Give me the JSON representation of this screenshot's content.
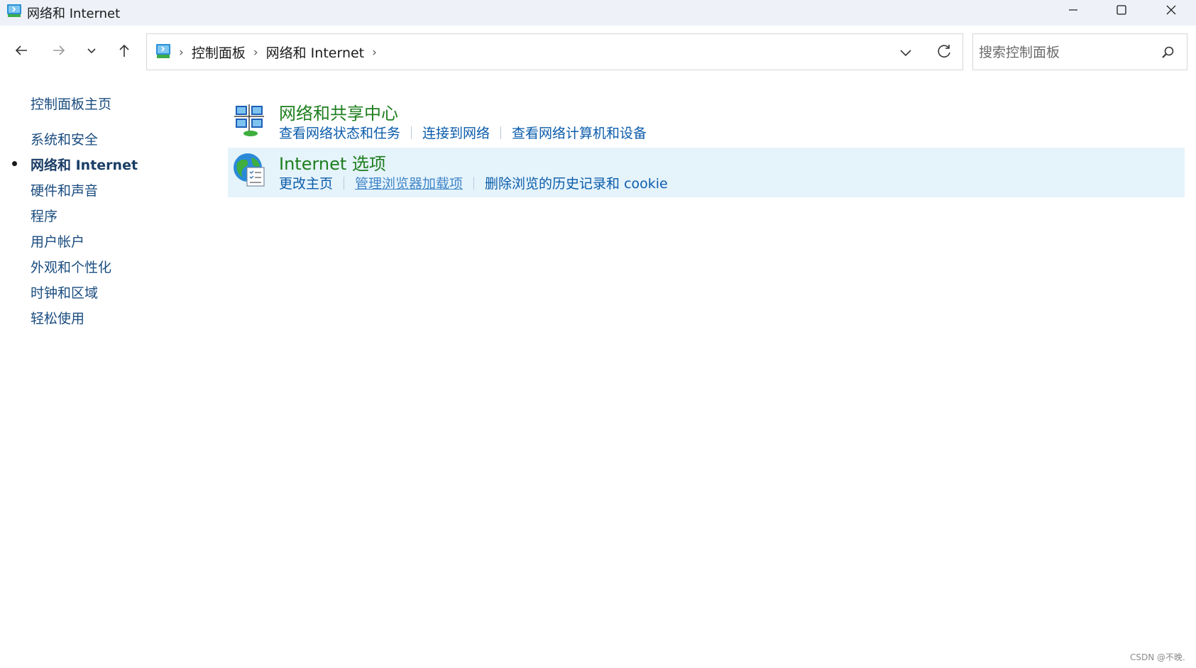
{
  "window": {
    "title": "网络和 Internet",
    "icons": {
      "app": "control-panel-icon",
      "minimize": "minimize-icon",
      "maximize": "maximize-icon",
      "close": "close-icon"
    }
  },
  "nav": {
    "back_icon": "arrow-left-icon",
    "forward_icon": "arrow-right-icon",
    "recent_icon": "chevron-down-icon",
    "up_icon": "arrow-up-icon"
  },
  "address": {
    "crumbs": [
      "控制面板",
      "网络和 Internet"
    ],
    "dropdown_icon": "chevron-down-icon",
    "refresh_icon": "refresh-icon"
  },
  "search": {
    "placeholder": "搜索控制面板",
    "icon": "search-icon"
  },
  "sidebar": {
    "home": "控制面板主页",
    "items": [
      {
        "label": "系统和安全",
        "active": false
      },
      {
        "label": "网络和 Internet",
        "active": true
      },
      {
        "label": "硬件和声音",
        "active": false
      },
      {
        "label": "程序",
        "active": false
      },
      {
        "label": "用户帐户",
        "active": false
      },
      {
        "label": "外观和个性化",
        "active": false
      },
      {
        "label": "时钟和区域",
        "active": false
      },
      {
        "label": "轻松使用",
        "active": false
      }
    ]
  },
  "categories": [
    {
      "title": "网络和共享中心",
      "icon": "network-sharing-icon",
      "links": [
        "查看网络状态和任务",
        "连接到网络",
        "查看网络计算机和设备"
      ]
    },
    {
      "title": "Internet 选项",
      "icon": "internet-options-icon",
      "highlighted": true,
      "links": [
        "更改主页",
        "管理浏览器加载项",
        "删除浏览的历史记录和 cookie"
      ]
    }
  ],
  "colors": {
    "titlebar_bg": "#eef2f8",
    "link": "#0b5cab",
    "category_title": "#1e7e1e",
    "highlight_bg": "#e5f3fb"
  },
  "watermark": "CSDN @不晚."
}
